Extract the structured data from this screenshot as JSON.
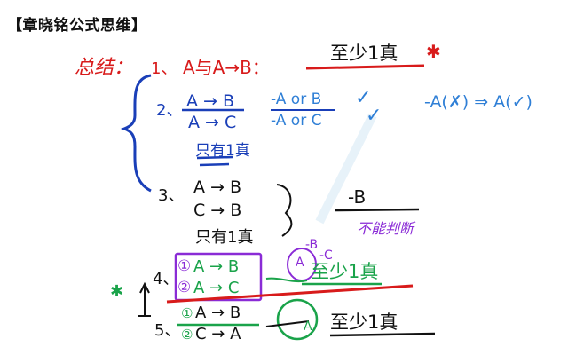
{
  "header": {
    "title": "【章晓铭公式思维】"
  },
  "notes": {
    "summary_label": "总结：",
    "item1": {
      "num": "1、",
      "text": "A与A→B：",
      "result": "至少1真",
      "mark": "✱"
    },
    "item2": {
      "num": "2、",
      "top": "A → B",
      "bottom": "A → C",
      "conclusion": "只有1真",
      "side1": "-A or B",
      "side2": "-A or C",
      "check": "✓",
      "note": "-A(✗) ⇒ A(✓)"
    },
    "item3": {
      "num": "3、",
      "lines": [
        "A → B",
        "C → B",
        "只有1真"
      ],
      "result": "-B",
      "note": "不能判断"
    },
    "item4": {
      "num": "4、",
      "circle1": "①",
      "circle2": "②",
      "line1": "A → B",
      "line2": "A → C",
      "bubble1": "-B",
      "bubble2": "-C",
      "bubble_a": "A",
      "result": "至少1真"
    },
    "item5": {
      "num": "5、",
      "circle1": "①",
      "circle2": "②",
      "line1": "A → B",
      "line2": "C → A",
      "bubble": "A",
      "result": "至少1真"
    }
  }
}
